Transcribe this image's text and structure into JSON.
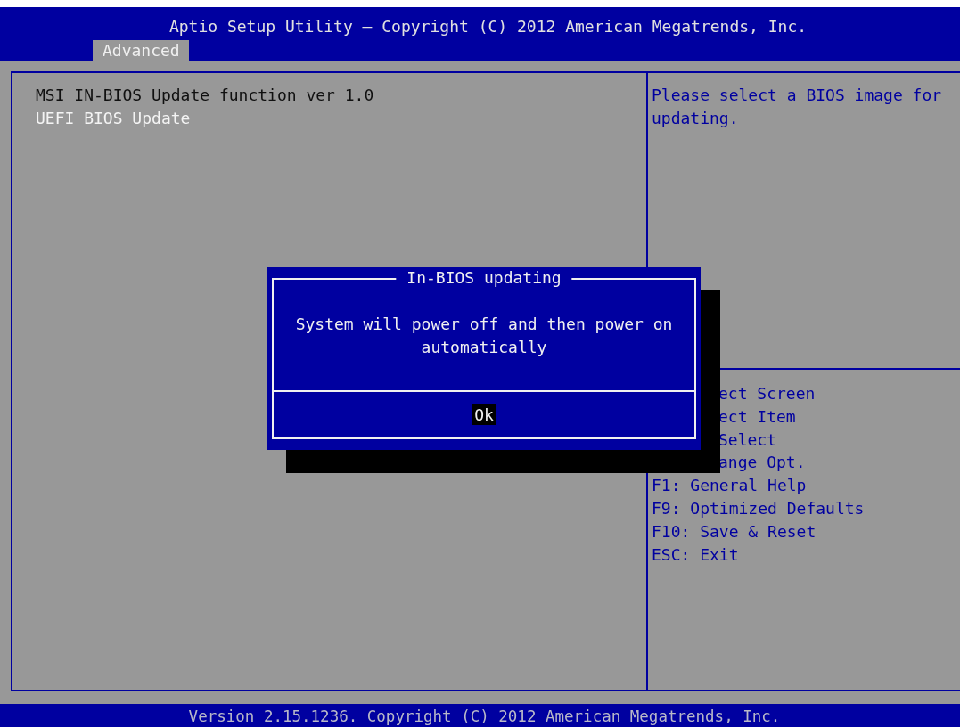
{
  "header": {
    "title": "Aptio Setup Utility – Copyright (C) 2012 American Megatrends, Inc.",
    "tabs": [
      {
        "label": "Advanced",
        "selected": true
      }
    ]
  },
  "main_items": [
    {
      "kind": "label",
      "text": "MSI IN-BIOS Update function ver 1.0"
    },
    {
      "kind": "item",
      "text": "UEFI BIOS Update"
    }
  ],
  "help_text": "Please select a BIOS image for updating.",
  "partly_hidden_key_help": [
    "ect Screen",
    "ect Item",
    "Select",
    "ange Opt."
  ],
  "key_help": [
    "F1: General Help",
    "F9: Optimized Defaults",
    "F10: Save & Reset",
    "ESC: Exit"
  ],
  "dialog": {
    "title": "In-BIOS updating",
    "message": "System will power off and then power on automatically",
    "buttons": [
      {
        "label": "Ok",
        "selected": true
      }
    ]
  },
  "footer": "Version 2.15.1236. Copyright (C) 2012 American Megatrends, Inc."
}
